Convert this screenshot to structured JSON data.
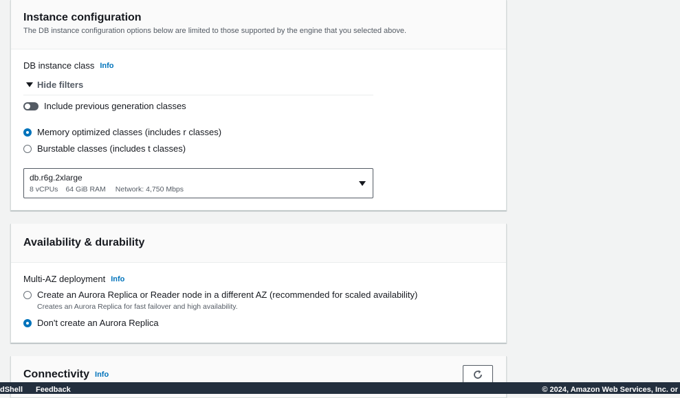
{
  "instance_config": {
    "title": "Instance configuration",
    "description": "The DB instance configuration options below are limited to those supported by the engine that you selected above.",
    "db_class_label": "DB instance class",
    "info_label": "Info",
    "hide_filters_label": "Hide filters",
    "include_prev_gen_label": "Include previous generation classes",
    "include_prev_gen_enabled": false,
    "class_options": [
      {
        "label": "Memory optimized classes (includes r classes)",
        "selected": true
      },
      {
        "label": "Burstable classes (includes t classes)",
        "selected": false
      }
    ],
    "selected_class": {
      "name": "db.r6g.2xlarge",
      "vcpus": "8 vCPUs",
      "ram": "64 GiB RAM",
      "network": "Network: 4,750 Mbps"
    }
  },
  "availability": {
    "title": "Availability & durability",
    "multi_az_label": "Multi-AZ deployment",
    "info_label": "Info",
    "options": [
      {
        "label": "Create an Aurora Replica or Reader node in a different AZ (recommended for scaled availability)",
        "description": "Creates an Aurora Replica for fast failover and high availability.",
        "selected": false
      },
      {
        "label": "Don't create an Aurora Replica",
        "selected": true
      }
    ]
  },
  "connectivity": {
    "title": "Connectivity",
    "info_label": "Info"
  },
  "footer": {
    "cloudshell_label": "dShell",
    "feedback_label": "Feedback",
    "copyright": "© 2024, Amazon Web Services, Inc. or"
  }
}
